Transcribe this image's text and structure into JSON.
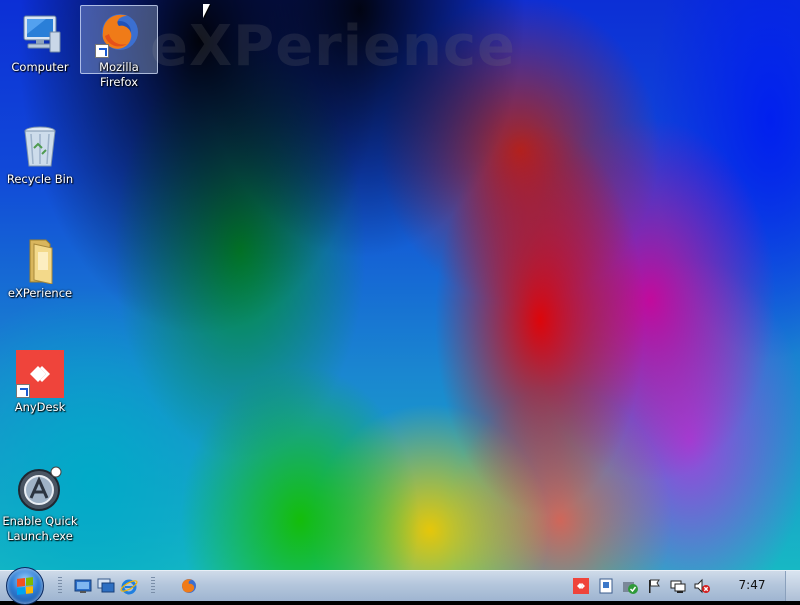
{
  "desktop": {
    "watermark": "eXPerience",
    "icons": [
      {
        "label": "Computer",
        "icon": "computer-icon"
      },
      {
        "label": "Mozilla Firefox",
        "icon": "firefox-icon",
        "selected": true
      },
      {
        "label": "Recycle Bin",
        "icon": "recycle-bin-icon"
      },
      {
        "label": "eXPerience",
        "icon": "folder-icon"
      },
      {
        "label": "AnyDesk",
        "icon": "anydesk-icon"
      },
      {
        "label": "Enable Quick Launch.exe",
        "icon": "quick-launch-icon"
      }
    ]
  },
  "taskbar": {
    "start_icon": "windows-start-orb",
    "quick_launch": [
      "show-desktop-icon",
      "switch-windows-icon",
      "internet-explorer-icon"
    ],
    "running": [
      "firefox-icon"
    ],
    "tray": [
      "anydesk-tray-icon",
      "document-tray-icon",
      "security-tray-icon",
      "action-center-flag-icon",
      "network-icon",
      "volume-muted-icon"
    ],
    "clock": "7:47"
  },
  "colors": {
    "taskbar_top": "#cfdbe9",
    "taskbar_bottom": "#9fb5d1",
    "anydesk_red": "#ef443b",
    "selection": "#b4c8e6"
  }
}
